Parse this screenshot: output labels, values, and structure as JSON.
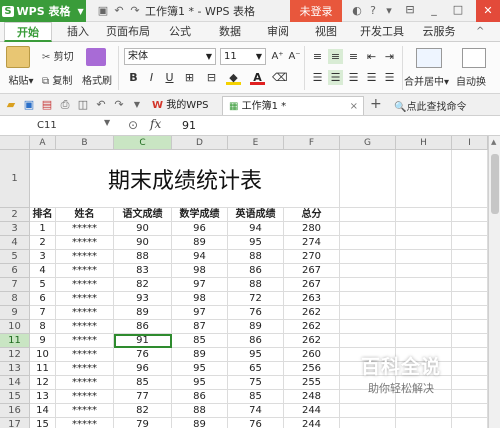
{
  "titlebar": {
    "app_name": "WPS 表格",
    "app_logo": "S",
    "doc_title": "工作簿1 * - WPS 表格",
    "login_label": "未登录",
    "win_controls": [
      "_",
      "□",
      "✕"
    ]
  },
  "menu": {
    "tabs": [
      "开始",
      "插入",
      "页面布局",
      "公式",
      "数据",
      "审阅",
      "视图",
      "开发工具",
      "云服务"
    ],
    "active": "开始"
  },
  "ribbon": {
    "paste": "粘贴",
    "cut": "剪切",
    "copy": "复制",
    "format_painter": "格式刷",
    "font_name": "宋体",
    "font_size": "11",
    "bold": "B",
    "italic": "I",
    "underline": "U",
    "merge_center": "合并居中",
    "auto_wrap": "自动换",
    "font_color_accent": "#e02020",
    "fill_color_accent": "#f5d200"
  },
  "quickbar": {
    "my_wps": "我的WPS",
    "doc_tab": "工作簿1 *",
    "add_tab": "+",
    "search": "点此查找命令"
  },
  "formula": {
    "cell_ref": "C11",
    "fx": "fx",
    "value": "91"
  },
  "sheet": {
    "columns": [
      "A",
      "B",
      "C",
      "D",
      "E",
      "F",
      "G",
      "H",
      "I"
    ],
    "title": "期末成绩统计表",
    "headers": [
      "排名",
      "姓名",
      "语文成绩",
      "数学成绩",
      "英语成绩",
      "总分"
    ],
    "rows": [
      [
        "1",
        "*****",
        "90",
        "96",
        "94",
        "280"
      ],
      [
        "2",
        "*****",
        "90",
        "89",
        "95",
        "274"
      ],
      [
        "3",
        "*****",
        "88",
        "94",
        "88",
        "270"
      ],
      [
        "4",
        "*****",
        "83",
        "98",
        "86",
        "267"
      ],
      [
        "5",
        "*****",
        "82",
        "97",
        "88",
        "267"
      ],
      [
        "6",
        "*****",
        "93",
        "98",
        "72",
        "263"
      ],
      [
        "7",
        "*****",
        "89",
        "97",
        "76",
        "262"
      ],
      [
        "8",
        "*****",
        "86",
        "87",
        "89",
        "262"
      ],
      [
        "9",
        "*****",
        "91",
        "85",
        "86",
        "262"
      ],
      [
        "10",
        "*****",
        "76",
        "89",
        "95",
        "260"
      ],
      [
        "11",
        "*****",
        "96",
        "95",
        "65",
        "256"
      ],
      [
        "12",
        "*****",
        "85",
        "95",
        "75",
        "255"
      ],
      [
        "13",
        "*****",
        "77",
        "86",
        "85",
        "248"
      ],
      [
        "14",
        "*****",
        "82",
        "88",
        "74",
        "244"
      ],
      [
        "15",
        "*****",
        "79",
        "89",
        "76",
        "244"
      ]
    ],
    "row_numbers": [
      "1",
      "2",
      "3",
      "4",
      "5",
      "6",
      "7",
      "8",
      "9",
      "10",
      "11",
      "12",
      "13",
      "14",
      "15",
      "16",
      "17"
    ]
  },
  "watermark": {
    "title": "百科全说",
    "subtitle": "助你轻松解决"
  }
}
